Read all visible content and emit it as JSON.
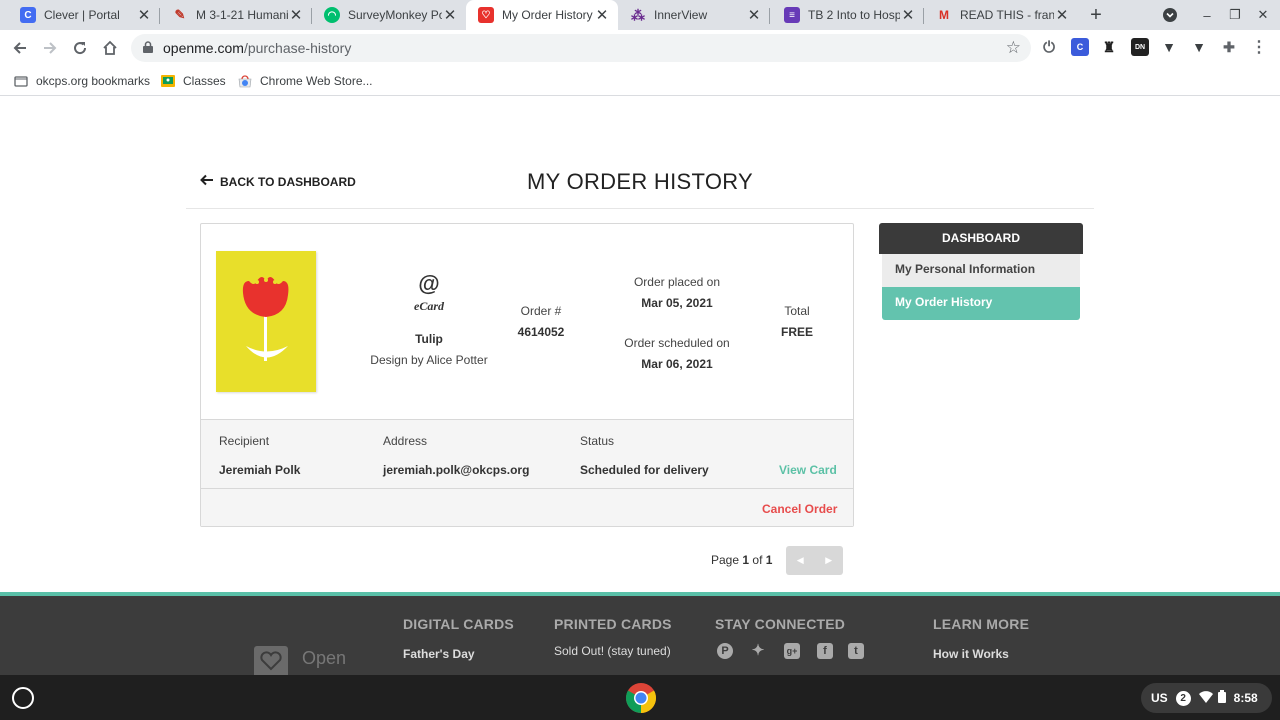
{
  "browser": {
    "tabs": [
      {
        "label": "Clever | Portal",
        "icon": "clever-icon"
      },
      {
        "label": "M 3-1-21 Humanit",
        "icon": "feather-icon"
      },
      {
        "label": "SurveyMonkey Po",
        "icon": "surveymonkey-icon"
      },
      {
        "label": "My Order History |",
        "icon": "openme-icon",
        "active": true
      },
      {
        "label": "InnerView",
        "icon": "innerview-icon"
      },
      {
        "label": "TB 2 Into to Hospi",
        "icon": "forms-icon"
      },
      {
        "label": "READ THIS - frank",
        "icon": "gmail-icon"
      }
    ],
    "url_host": "openme.com",
    "url_path": "/purchase-history",
    "bookmarks": [
      {
        "label": "okcps.org bookmarks",
        "icon": "folder-icon"
      },
      {
        "label": "Classes",
        "icon": "classroom-icon"
      },
      {
        "label": "Chrome Web Store...",
        "icon": "webstore-icon"
      }
    ]
  },
  "page": {
    "back_label": "BACK TO DASHBOARD",
    "title": "MY ORDER HISTORY"
  },
  "order": {
    "ecard_symbol": "@",
    "ecard_label": "eCard",
    "card_name": "Tulip",
    "design_by": "Design by Alice Potter",
    "order_no_label": "Order #",
    "order_no": "4614052",
    "placed_label": "Order placed on",
    "placed_date": "Mar 05, 2021",
    "scheduled_label": "Order scheduled on",
    "scheduled_date": "Mar 06, 2021",
    "total_label": "Total",
    "total_value": "FREE",
    "recipient_label": "Recipient",
    "recipient": "Jeremiah Polk",
    "address_label": "Address",
    "address": "jeremiah.polk@okcps.org",
    "status_label": "Status",
    "status": "Scheduled for delivery",
    "view_card": "View Card",
    "cancel": "Cancel Order"
  },
  "sidebar": {
    "head": "DASHBOARD",
    "items": [
      {
        "label": "My Personal Information"
      },
      {
        "label": "My Order History",
        "active": true
      }
    ]
  },
  "pager": {
    "prefix": "Page",
    "current": "1",
    "of": "of",
    "total": "1"
  },
  "footer": {
    "headings": [
      "DIGITAL CARDS",
      "PRINTED CARDS",
      "STAY CONNECTED",
      "LEARN MORE"
    ],
    "digital_first": "Father's Day",
    "printed_note": "Sold Out! (stay tuned)",
    "learn_first": "How it Works",
    "logo_text": "Open"
  },
  "shelf": {
    "lang": "US",
    "notif_count": "2",
    "time": "8:58"
  },
  "colors": {
    "accent_teal": "#63c3ae",
    "cancel_red": "#e74c4c",
    "card_yellow": "#e8df2a",
    "tulip_red": "#e8322d"
  }
}
